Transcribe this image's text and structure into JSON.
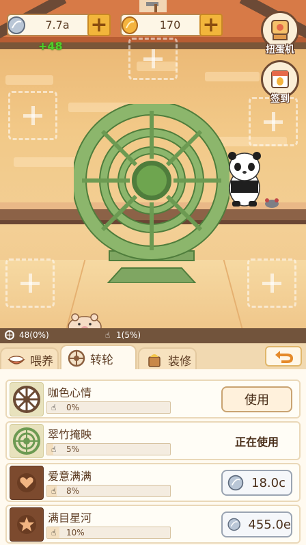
{
  "currency": {
    "silver_value": "7.7a",
    "gold_value": "170",
    "gain": "+48"
  },
  "side_buttons": [
    {
      "label": "扭蛋机",
      "icon": "gacha-machine-icon"
    },
    {
      "label": "签到",
      "icon": "calendar-icon"
    }
  ],
  "status": {
    "wheel_count": "48(0%)",
    "tap_count": "1(5%)"
  },
  "tabs": [
    {
      "label": "喂养",
      "icon": "bowl-icon",
      "active": false
    },
    {
      "label": "转轮",
      "icon": "wheel-icon",
      "active": true
    },
    {
      "label": "装修",
      "icon": "paint-icon",
      "active": false
    }
  ],
  "wheels": [
    {
      "name": "咖色心情",
      "percent": "0%",
      "fill": 0.0,
      "action": "使用",
      "action_type": "use"
    },
    {
      "name": "翠竹掩映",
      "percent": "5%",
      "fill": 0.05,
      "action": "正在使用",
      "action_type": "inuse"
    },
    {
      "name": "爱意满满",
      "percent": "8%",
      "fill": 0.08,
      "action": "18.0c",
      "action_type": "buy"
    },
    {
      "name": "满目星河",
      "percent": "10%",
      "fill": 0.1,
      "action": "455.0e",
      "action_type": "buy"
    }
  ],
  "colors": {
    "wheel_green": "#7fa662",
    "panel_bg": "#fffaf0",
    "accent_orange": "#f2b53b"
  }
}
